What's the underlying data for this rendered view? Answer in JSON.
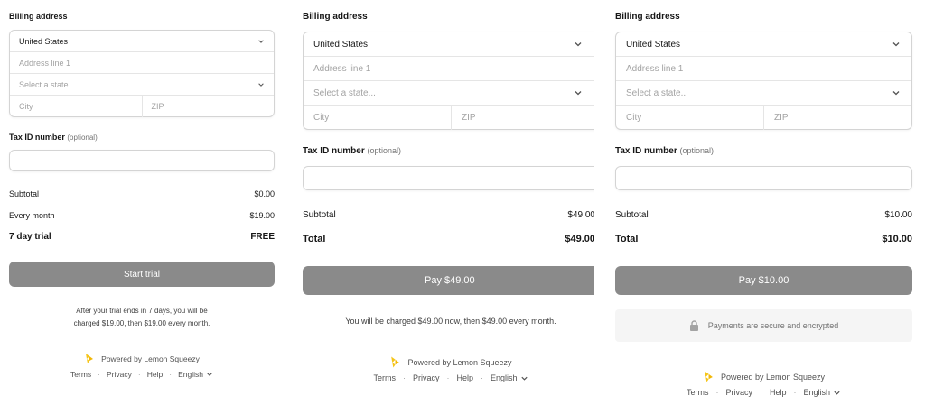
{
  "panels": [
    {
      "billing_label": "Billing address",
      "country": "United States",
      "address_placeholder": "Address line 1",
      "state_placeholder": "Select a state...",
      "city_placeholder": "City",
      "zip_placeholder": "ZIP",
      "tax_label": "Tax ID number",
      "tax_optional": "(optional)",
      "lines": [
        {
          "label": "Subtotal",
          "value": "$0.00"
        },
        {
          "label": "Every month",
          "value": "$19.00"
        },
        {
          "label": "7 day trial",
          "value": "FREE"
        }
      ],
      "button": "Start trial",
      "note_line1": "After your trial ends in 7 days, you will be",
      "note_line2": "charged $19.00, then $19.00 every month.",
      "powered": "Powered by Lemon Squeezy",
      "links": [
        "Terms",
        "Privacy",
        "Help",
        "English"
      ]
    },
    {
      "billing_label": "Billing address",
      "country": "United States",
      "address_placeholder": "Address line 1",
      "state_placeholder": "Select a state...",
      "city_placeholder": "City",
      "zip_placeholder": "ZIP",
      "tax_label": "Tax ID number",
      "tax_optional": "(optional)",
      "lines": [
        {
          "label": "Subtotal",
          "value": "$49.00"
        },
        {
          "label": "Total",
          "value": "$49.00"
        }
      ],
      "button": "Pay $49.00",
      "note": "You will be charged $49.00 now, then $49.00 every month.",
      "powered": "Powered by Lemon Squeezy",
      "links": [
        "Terms",
        "Privacy",
        "Help",
        "English"
      ]
    },
    {
      "billing_label": "Billing address",
      "country": "United States",
      "address_placeholder": "Address line 1",
      "state_placeholder": "Select a state...",
      "city_placeholder": "City",
      "zip_placeholder": "ZIP",
      "tax_label": "Tax ID number",
      "tax_optional": "(optional)",
      "lines": [
        {
          "label": "Subtotal",
          "value": "$10.00"
        },
        {
          "label": "Total",
          "value": "$10.00"
        }
      ],
      "button": "Pay $10.00",
      "secure": "Payments are secure and encrypted",
      "powered": "Powered by Lemon Squeezy",
      "links": [
        "Terms",
        "Privacy",
        "Help",
        "English"
      ]
    }
  ],
  "colors": {
    "button_bg": "#8a8a8a",
    "lemon": "#f5c518",
    "border": "#d4d4d4",
    "muted": "#a3a3a3"
  },
  "icons": [
    "chevron-down-icon",
    "lock-icon",
    "lemon-squeezy-logo-icon"
  ]
}
